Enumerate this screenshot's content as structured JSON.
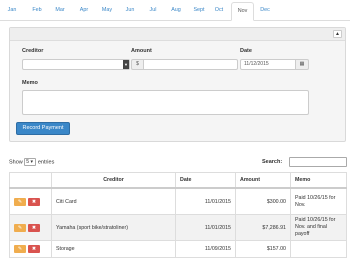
{
  "tabs": {
    "months": [
      "Jan",
      "Feb",
      "Mar",
      "Apr",
      "May",
      "Jun",
      "Jul",
      "Aug",
      "Sept",
      "Oct",
      "Nov",
      "Dec"
    ],
    "active": "Nov"
  },
  "form": {
    "collapse_icon": "chevron-up-icon",
    "creditor_label": "Creditor",
    "creditor_value": "",
    "amount_label": "Amount",
    "amount_prefix": "$",
    "amount_value": "",
    "date_label": "Date",
    "date_value": "11/12/2015",
    "calendar_icon": "calendar-icon",
    "memo_label": "Memo",
    "memo_value": "",
    "submit_label": "Record Payment"
  },
  "table_controls": {
    "show_label": "Show",
    "page_size": "5",
    "entries_label": "entries",
    "search_label": "Search:",
    "search_value": ""
  },
  "table": {
    "headers": [
      "",
      "Creditor",
      "Date",
      "Amount",
      "Memo"
    ],
    "rows": [
      {
        "creditor": "Citi Card",
        "date": "11/01/2015",
        "amount": "$300.00",
        "memo": "Paid 10/26/15 for Nov."
      },
      {
        "creditor": "Yamaha (sport bike/stratoliner)",
        "date": "11/01/2015",
        "amount": "$7,286.91",
        "memo": "Paid 10/26/15 for Nov. and final payoff"
      },
      {
        "creditor": "Storage",
        "date": "11/09/2015",
        "amount": "$157.00",
        "memo": ""
      }
    ]
  },
  "colors": {
    "accent": "#3a87c8",
    "edit": "#f0ad4e",
    "delete": "#d9534f"
  }
}
